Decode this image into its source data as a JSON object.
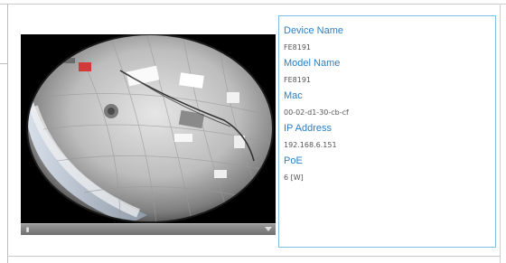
{
  "device_info": {
    "fields": [
      {
        "label": "Device Name",
        "value": "FE8191"
      },
      {
        "label": "Model Name",
        "value": "FE8191"
      },
      {
        "label": "Mac",
        "value": "00-02-d1-30-cb-cf"
      },
      {
        "label": "IP Address",
        "value": "192.168.6.151"
      },
      {
        "label": "PoE",
        "value": "6 [W]"
      }
    ]
  },
  "player": {
    "play_icon": "play-icon",
    "menu_icon": "chevron-down-icon"
  },
  "colors": {
    "label_accent": "#2a7fc4",
    "panel_border": "#7ec0e6"
  }
}
